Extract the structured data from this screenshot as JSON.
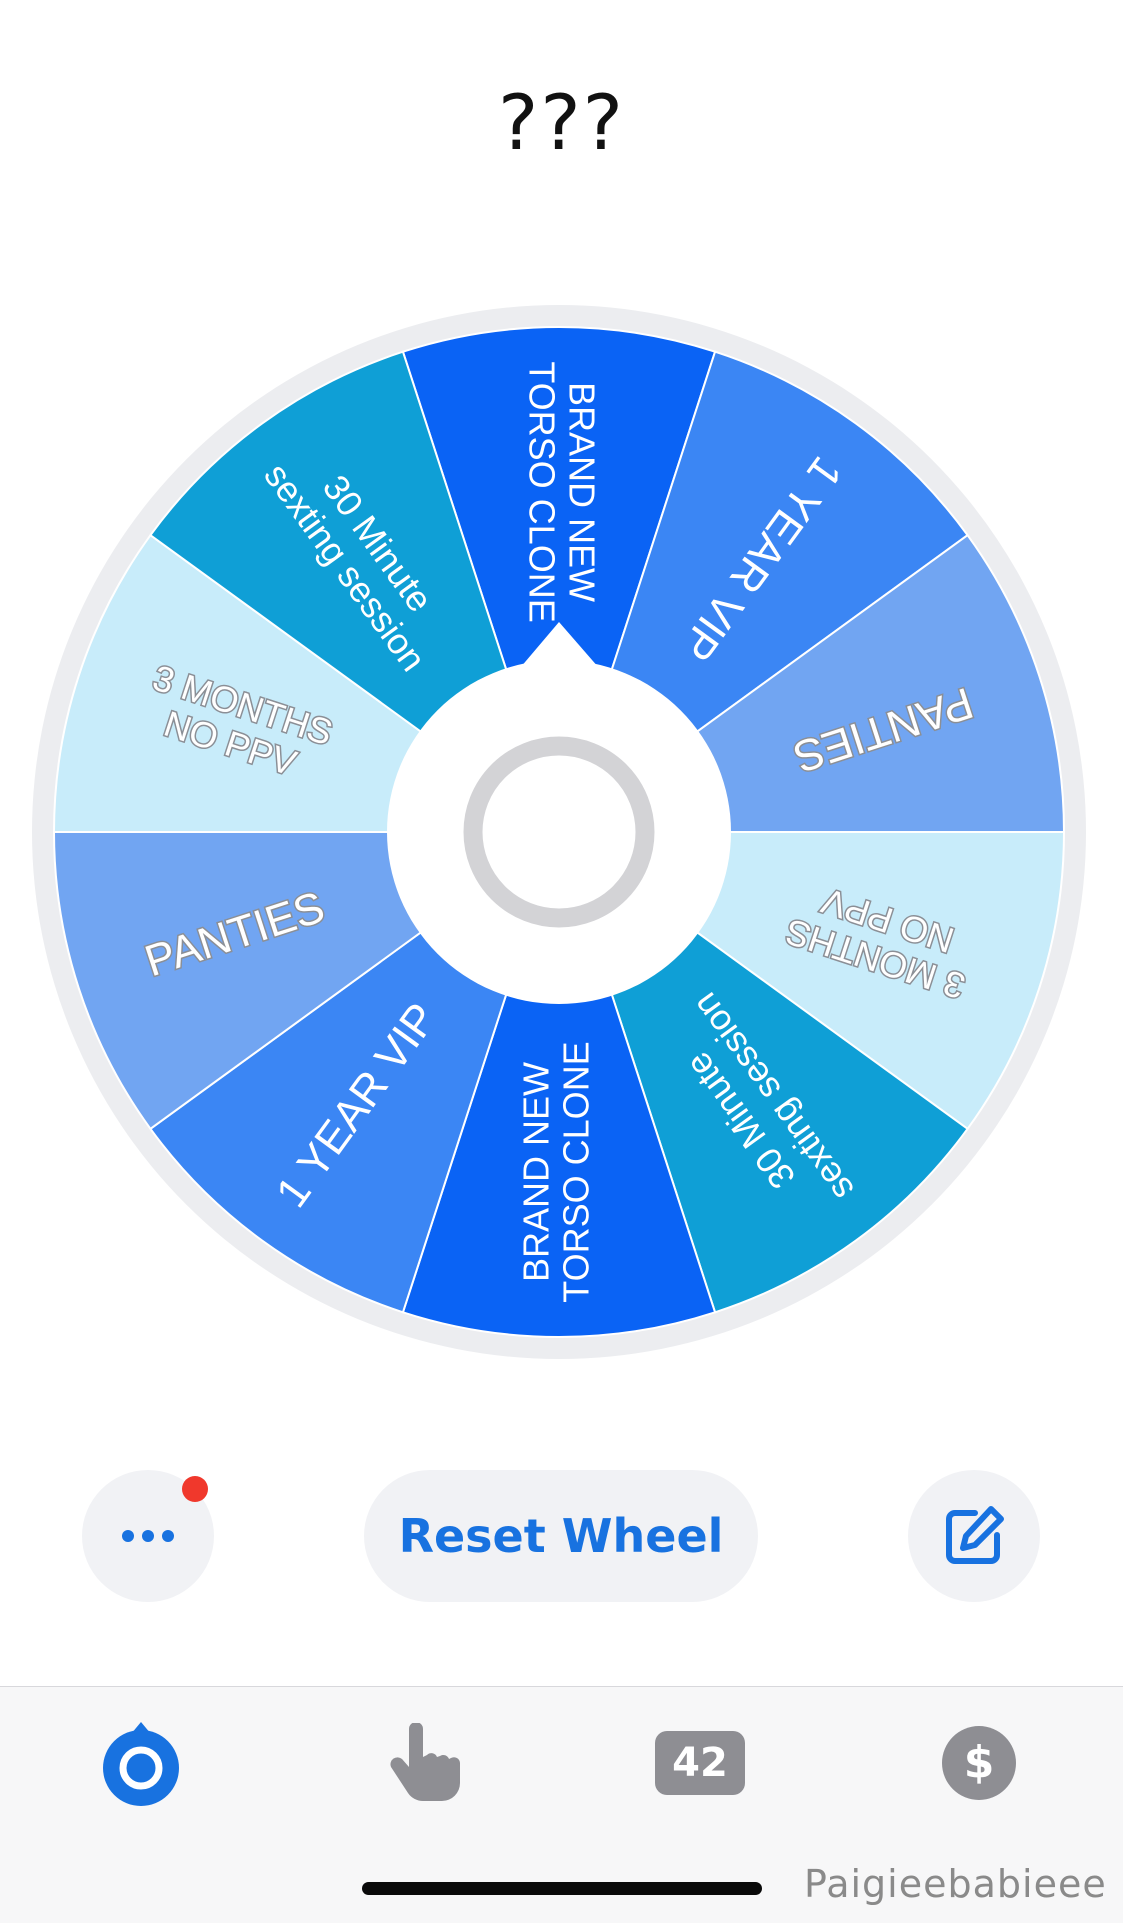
{
  "title": "???",
  "wheel": {
    "segments": [
      {
        "lines": [
          "BRAND NEW",
          "TORSO CLONE"
        ],
        "color": "#0a63f5",
        "text_style": "plain"
      },
      {
        "lines": [
          "1 YEAR VIP"
        ],
        "color": "#3b86f4",
        "text_style": "plain"
      },
      {
        "lines": [
          "PANTIES"
        ],
        "color": "#71a5f2",
        "text_style": "outlined"
      },
      {
        "lines": [
          "3 MONTHS",
          "NO PPV"
        ],
        "color": "#c8ecfa",
        "text_style": "outlined"
      },
      {
        "lines": [
          "30 Minute",
          "sexting session"
        ],
        "color": "#0f9fd6",
        "text_style": "plain"
      },
      {
        "lines": [
          "BRAND NEW",
          "TORSO CLONE"
        ],
        "color": "#0a63f5",
        "text_style": "plain"
      },
      {
        "lines": [
          "1 YEAR VIP"
        ],
        "color": "#3b86f4",
        "text_style": "plain"
      },
      {
        "lines": [
          "PANTIES"
        ],
        "color": "#71a5f2",
        "text_style": "outlined"
      },
      {
        "lines": [
          "3 MONTHS",
          "NO PPV"
        ],
        "color": "#c8ecfa",
        "text_style": "outlined"
      },
      {
        "lines": [
          "30 Minute",
          "sexting session"
        ],
        "color": "#0f9fd6",
        "text_style": "plain"
      }
    ]
  },
  "buttons": {
    "more_icon": "ellipsis-icon",
    "reset_label": "Reset Wheel",
    "edit_icon": "edit-icon"
  },
  "tab_bar": {
    "tabs": [
      {
        "name": "wheel",
        "icon": "wheel-icon",
        "active": true
      },
      {
        "name": "tap",
        "icon": "hand-pointer-icon",
        "active": false
      },
      {
        "name": "count",
        "icon": "count-badge-icon",
        "badge": "42",
        "active": false
      },
      {
        "name": "dollar",
        "icon": "dollar-icon",
        "active": false
      }
    ]
  },
  "colors": {
    "accent": "#1872e0",
    "notification": "#f0382c",
    "inactive_icon": "#8e8e93"
  },
  "watermark": "Paigieebabieee"
}
